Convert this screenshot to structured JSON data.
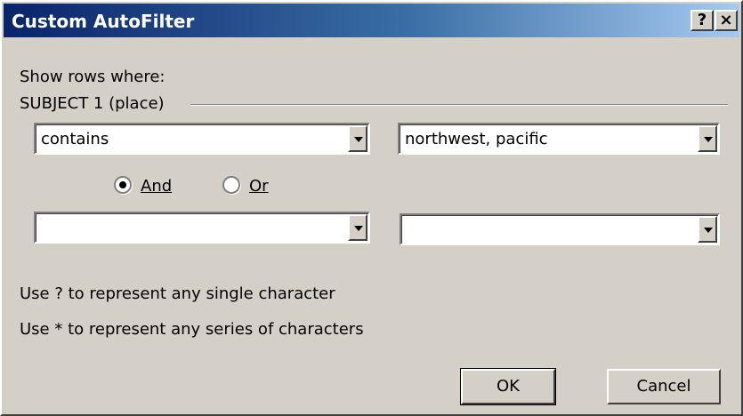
{
  "window": {
    "title": "Custom AutoFilter",
    "help_label": "?",
    "close_label": "×"
  },
  "filter": {
    "show_rows_label": "Show rows where:",
    "field_label": "SUBJECT 1 (place)",
    "condition1": {
      "operator": "contains",
      "value": "northwest, pacific"
    },
    "logic": {
      "and_label": "And",
      "or_label": "Or",
      "selected": "And"
    },
    "condition2": {
      "operator": "",
      "value": ""
    },
    "hint1": "Use ? to represent any single character",
    "hint2": "Use * to represent any series of characters"
  },
  "buttons": {
    "ok": "OK",
    "cancel": "Cancel"
  }
}
